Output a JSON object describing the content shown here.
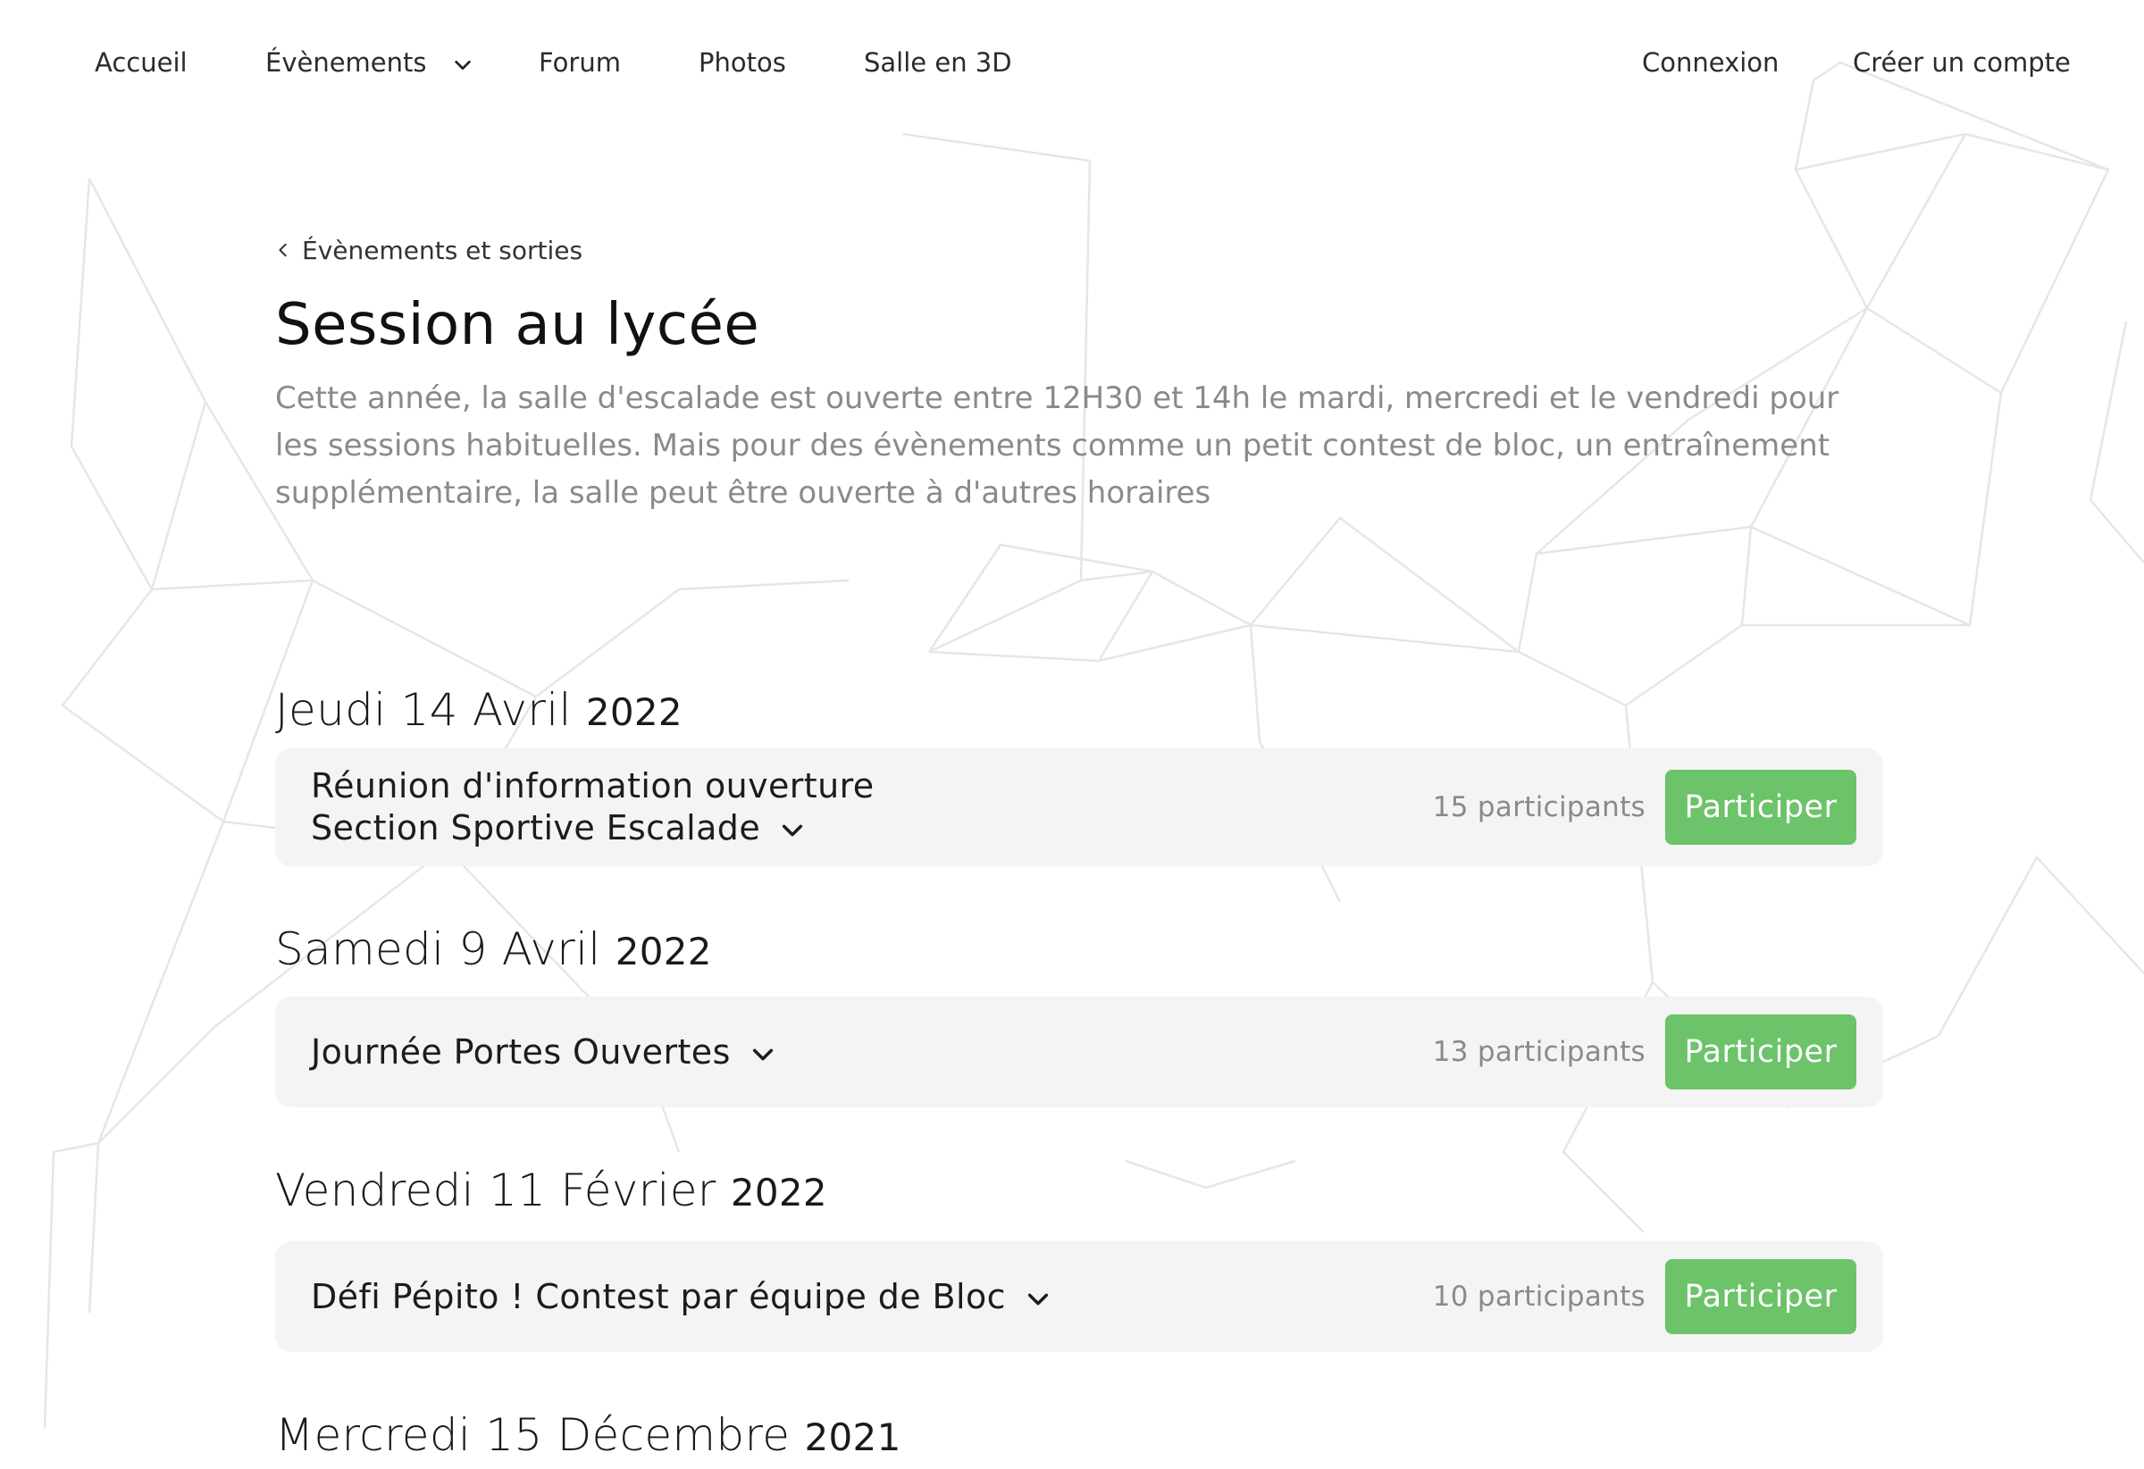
{
  "nav": {
    "items": [
      {
        "label": "Accueil"
      },
      {
        "label": "Évènements"
      },
      {
        "label": "Forum"
      },
      {
        "label": "Photos"
      },
      {
        "label": "Salle en 3D"
      }
    ],
    "login": "Connexion",
    "register": "Créer un compte"
  },
  "breadcrumb": {
    "label": "Évènements et sorties"
  },
  "page": {
    "title": "Session au lycée",
    "intro": "Cette année, la salle d'escalade est ouverte entre 12H30 et 14h le mardi, mercredi et le vendredi pour les sessions habituelles. Mais pour des évènements comme un petit contest de bloc, un entraînement supplémentaire, la salle peut être ouverte à d'autres horaires"
  },
  "events": [
    {
      "date": "Jeudi 14 Avril",
      "year": "2022",
      "title": "Réunion d'information ouverture Section Sportive Escalade",
      "participants": "15 participants",
      "button": "Participer"
    },
    {
      "date": "Samedi 9 Avril",
      "year": "2022",
      "title": "Journée Portes Ouvertes",
      "participants": "13 participants",
      "button": "Participer"
    },
    {
      "date": "Vendredi 11 Février",
      "year": "2022",
      "title": "Défi Pépito ! Contest par équipe de Bloc",
      "participants": "10 participants",
      "button": "Participer"
    },
    {
      "date": "Mercredi 15 Décembre",
      "year": "2021"
    }
  ],
  "colors": {
    "accent": "#6cc36a",
    "card_bg": "#f4f4f4",
    "muted_text": "#8a8a8a"
  }
}
